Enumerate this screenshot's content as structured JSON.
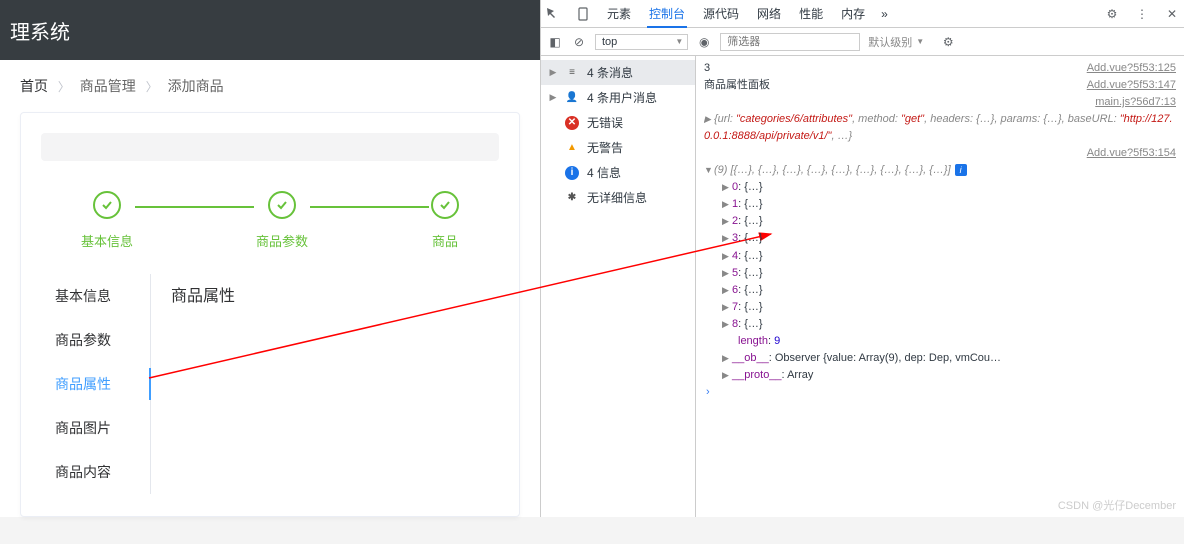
{
  "header": {
    "title": "理系统"
  },
  "breadcrumb": {
    "home": "首页",
    "mid": "商品管理",
    "last": "添加商品",
    "sep": "〉"
  },
  "steps": [
    {
      "label": "基本信息"
    },
    {
      "label": "商品参数"
    },
    {
      "label": "商品"
    }
  ],
  "tabs": [
    {
      "label": "基本信息",
      "active": false
    },
    {
      "label": "商品参数",
      "active": false
    },
    {
      "label": "商品属性",
      "active": true
    },
    {
      "label": "商品图片",
      "active": false
    },
    {
      "label": "商品内容",
      "active": false
    }
  ],
  "content": {
    "title": "商品属性"
  },
  "devtools": {
    "tabs": [
      "元素",
      "控制台",
      "源代码",
      "网络",
      "性能",
      "内存"
    ],
    "active_tab": "控制台",
    "more": "»",
    "context": "top",
    "filter_placeholder": "筛选器",
    "level": "默认级别",
    "sidebar": [
      {
        "icon": "list",
        "label": "4 条消息",
        "tri": true,
        "sel": true
      },
      {
        "icon": "user",
        "label": "4 条用户消息",
        "tri": true
      },
      {
        "icon": "err",
        "label": "无错误"
      },
      {
        "icon": "warn",
        "label": "无警告"
      },
      {
        "icon": "info",
        "label": "4 信息"
      },
      {
        "icon": "verb",
        "label": "无详细信息"
      }
    ],
    "log": {
      "first": {
        "val": "3",
        "src": "Add.vue?5f53:125"
      },
      "second": {
        "val": "商品属性面板",
        "src": "Add.vue?5f53:147"
      },
      "third_src": "main.js?56d7:13",
      "req": {
        "prefix": "{url: ",
        "url": "\"categories/6/attributes\"",
        "mid1": ", method: ",
        "method": "\"get\"",
        "mid2": ", headers: {…}, params: {…}, baseURL: ",
        "base": "\"http://127.0.0.1:8888/api/private/v1/\"",
        "suffix": ", …}"
      },
      "arr_src": "Add.vue?5f53:154",
      "arr_head": "(9) [{…}, {…}, {…}, {…}, {…}, {…}, {…}, {…}, {…}]",
      "items": [
        "0",
        "1",
        "2",
        "3",
        "4",
        "5",
        "6",
        "7",
        "8"
      ],
      "length_key": "length",
      "length_val": "9",
      "ob_key": "__ob__",
      "ob_val": "Observer {value: Array(9), dep: Dep, vmCou…",
      "proto_key": "__proto__",
      "proto_val": "Array"
    }
  },
  "watermark": "CSDN @光仔December"
}
